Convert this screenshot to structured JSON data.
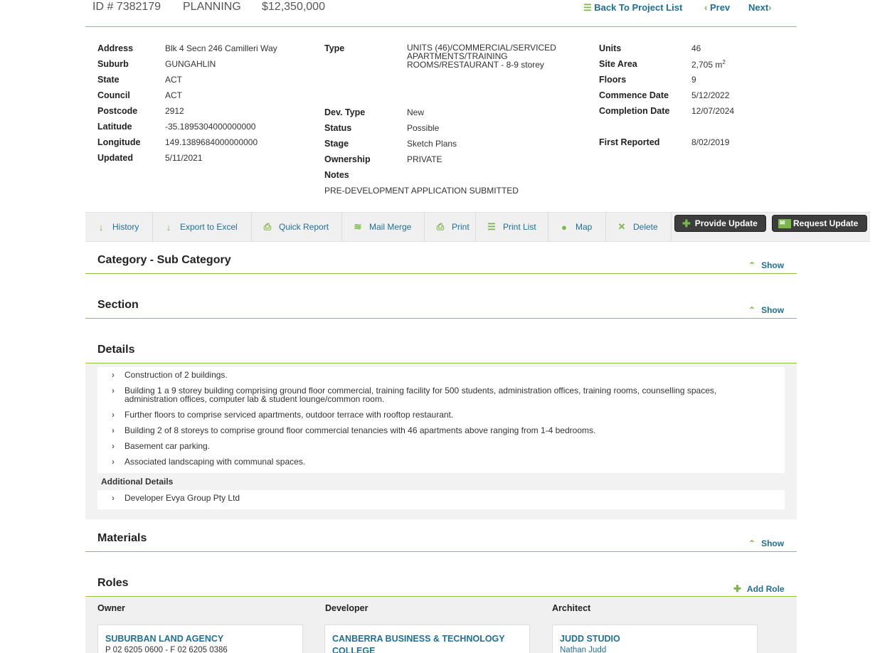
{
  "header": {
    "id": "ID # 7382179",
    "status": "PLANNING",
    "value": "$12,350,000",
    "back_label": "Back To Project List",
    "prev_label": "Prev",
    "next_label": "Next"
  },
  "col1": {
    "address_label": "Address",
    "address": "Blk 4 Secn 246 Camilleri Way",
    "suburb_label": "Suburb",
    "suburb": "GUNGAHLIN",
    "state_label": "State",
    "state": "ACT",
    "council_label": "Council",
    "council": "ACT",
    "postcode_label": "Postcode",
    "postcode": "2912",
    "latitude_label": "Latitude",
    "latitude": "-35.1895304000000000",
    "longitude_label": "Longitude",
    "longitude": "149.1389684000000000",
    "updated_label": "Updated",
    "updated": "5/11/2021"
  },
  "col2": {
    "type_label": "Type",
    "type_line1": "UNITS (46)/COMMERCIAL/SERVICED",
    "type_line2": "APARTMENTS/TRAINING",
    "type_line3": "ROOMS/RESTAURANT - 8-9 storey",
    "devtype_label": "Dev. Type",
    "devtype": "New",
    "status_label": "Status",
    "status": "Possible",
    "stage_label": "Stage",
    "stage": "Sketch Plans",
    "ownership_label": "Ownership",
    "ownership": "PRIVATE",
    "notes_label": "Notes",
    "notes": "PRE-DEVELOPMENT APPLICATION SUBMITTED"
  },
  "col3": {
    "units_label": "Units",
    "units": "46",
    "site_area_label": "Site Area",
    "site_area": "2,705 m",
    "site_area_unit_sup": "2",
    "floors_label": "Floors",
    "floors": "9",
    "commence_label": "Commence Date",
    "commence": "5/12/2022",
    "completion_label": "Completion Date",
    "completion": "12/07/2024",
    "first_reported_label": "First Reported",
    "first_reported": "8/02/2019"
  },
  "toolbar": {
    "history": "History",
    "export": "Export to Excel",
    "quick_report": "Quick Report",
    "mail_merge": "Mail Merge",
    "print": "Print",
    "print_list": "Print List",
    "map": "Map",
    "delete": "Delete",
    "provide_update": "Provide Update",
    "request_update": "Request Update"
  },
  "sections": {
    "category_title": "Category - Sub Category",
    "section_title": "Section",
    "details_title": "Details",
    "materials_title": "Materials",
    "roles_title": "Roles",
    "show_label": "Show",
    "add_role_label": "Add Role"
  },
  "details": {
    "items": [
      "Construction of 2 buildings.",
      "Building 1 a 9 storey building comprising ground floor commercial, training facility for 500 students, administration offices, training rooms, counselling spaces,",
      "administration offices, computer lab & student lounge/common room.",
      "Further floors to comprise serviced apartments, outdoor terrace with rooftop restaurant.",
      "Building 2 of 8 storeys to comprise ground floor commercial tenancies with 46 apartments above ranging from 1-4 bedrooms.",
      "Basement car parking.",
      "Associated landscaping with communal spaces."
    ],
    "additional_label": "Additional Details",
    "additional_item": "Developer Evya Group Pty Ltd"
  },
  "roles": {
    "owner_label": "Owner",
    "developer_label": "Developer",
    "architect_label": "Architect",
    "owner_name": "SUBURBAN LAND AGENCY",
    "owner_sub": "P 02 6205 0600 - F 02 6205 0386",
    "developer_name_line1": "CANBERRA BUSINESS & TECHNOLOGY",
    "developer_name_line2": "COLLEGE",
    "architect_name": "JUDD STUDIO",
    "architect_sub": "Nathan Judd"
  },
  "colors": {
    "accent_green": "#8cc63f",
    "link_blue": "#1f6f9a",
    "dark_button": "#3d3d3d"
  }
}
